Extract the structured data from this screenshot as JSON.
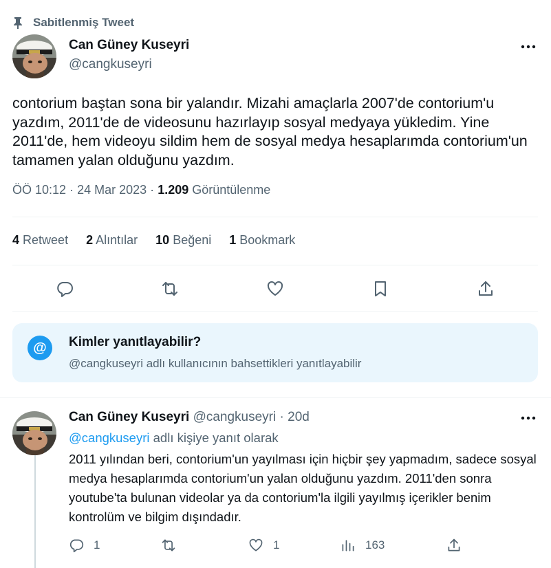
{
  "pinned": {
    "label": "Sabitlenmiş Tweet",
    "icon": "pin-icon"
  },
  "author": {
    "name": "Can Güney Kuseyri",
    "handle": "@cangkuseyri"
  },
  "tweet": {
    "text": "contorium baştan sona bir yalandır. Mizahi amaçlarla 2007'de contorium'u yazdım, 2011'de de videosunu hazırlayıp sosyal medyaya yükledim. Yine 2011'de, hem videoyu sildim hem de sosyal medya hesaplarımda contorium'un tamamen yalan olduğunu yazdım.",
    "time": "ÖÖ 10:12",
    "date": "24 Mar 2023",
    "dot": "·",
    "views_count": "1.209",
    "views_label": "Görüntülenme"
  },
  "stats": [
    {
      "count": "4",
      "label": "Retweet"
    },
    {
      "count": "2",
      "label": "Alıntılar"
    },
    {
      "count": "10",
      "label": "Beğeni"
    },
    {
      "count": "1",
      "label": "Bookmark"
    }
  ],
  "actions": [
    "reply-icon",
    "retweet-icon",
    "like-icon",
    "bookmark-icon",
    "share-icon"
  ],
  "who_can_reply": {
    "icon": "@",
    "title": "Kimler yanıtlayabilir?",
    "description": "@cangkuseyri adlı kullanıcının bahsettikleri yanıtlayabilir"
  },
  "reply": {
    "name": "Can Güney Kuseyri",
    "handle": "@cangkuseyri",
    "dot": "·",
    "age": "20d",
    "replying_to_handle": "@cangkuseyri",
    "replying_to_text": "adlı kişiye yanıt olarak",
    "text": "2011 yılından beri, contorium'un yayılması için hiçbir şey yapmadım, sadece sosyal medya hesaplarımda contorium'un yalan olduğunu yazdım. 2011'den sonra youtube'ta bulunan videolar ya da contorium'la ilgili yayılmış içerikler benim kontrolüm ve bilgim dışındadır.",
    "reply_count": "1",
    "retweet_count": "",
    "like_count": "1",
    "views_count": "163"
  },
  "colors": {
    "accent": "#1d9bf0",
    "muted": "#536471",
    "text": "#0f1419",
    "reply_box_bg": "#eaf6fd"
  }
}
